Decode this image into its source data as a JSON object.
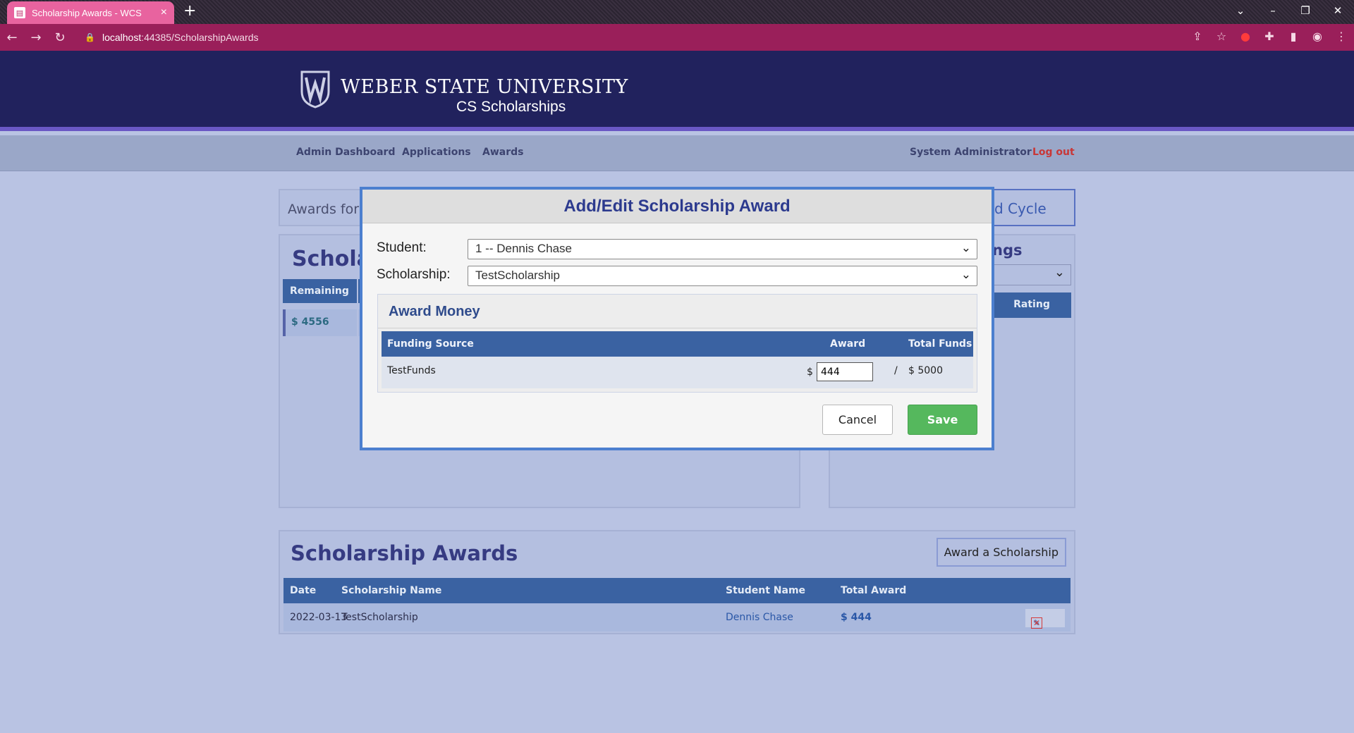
{
  "browser": {
    "tab_title": "Scholarship Awards - WCS",
    "url_host": "localhost",
    "url_rest": ":44385/ScholarshipAwards"
  },
  "site": {
    "university": "WEBER STATE UNIVERSITY",
    "subtitle": "CS Scholarships"
  },
  "nav": {
    "items": [
      "Admin Dashboard",
      "Applications",
      "Awards"
    ],
    "user": "System Administrator",
    "logout": "Log out"
  },
  "page": {
    "awards_for": "Awards for",
    "cycle_button": "d Cycle",
    "left_title": "Schola",
    "remaining_header": "Remaining",
    "remaining_value": "$ 4556",
    "right_title": "ngs",
    "rating_header": "Rating",
    "awards_title": "Scholarship Awards",
    "award_button": "Award a Scholarship",
    "awards_table": {
      "headers": [
        "Date",
        "Scholarship Name",
        "Student Name",
        "Total Award"
      ],
      "rows": [
        {
          "date": "2022-03-13",
          "scholarship": "TestScholarship",
          "student": "Dennis Chase",
          "total": "$ 444"
        }
      ]
    }
  },
  "modal": {
    "title": "Add/Edit Scholarship Award",
    "student_label": "Student:",
    "student_value": "1 -- Dennis Chase",
    "scholarship_label": "Scholarship:",
    "scholarship_value": "TestScholarship",
    "money_title": "Award Money",
    "table_headers": [
      "Funding Source",
      "Award",
      "Total Funds"
    ],
    "funding_row": {
      "source": "TestFunds",
      "currency": "$",
      "award_value": "444",
      "slash": "/",
      "total": "$ 5000"
    },
    "cancel_label": "Cancel",
    "save_label": "Save"
  },
  "colors": {
    "header_bg": "#21225d",
    "accent": "#3a62a2",
    "save_green": "#55b85d",
    "logout_red": "#c83737"
  }
}
